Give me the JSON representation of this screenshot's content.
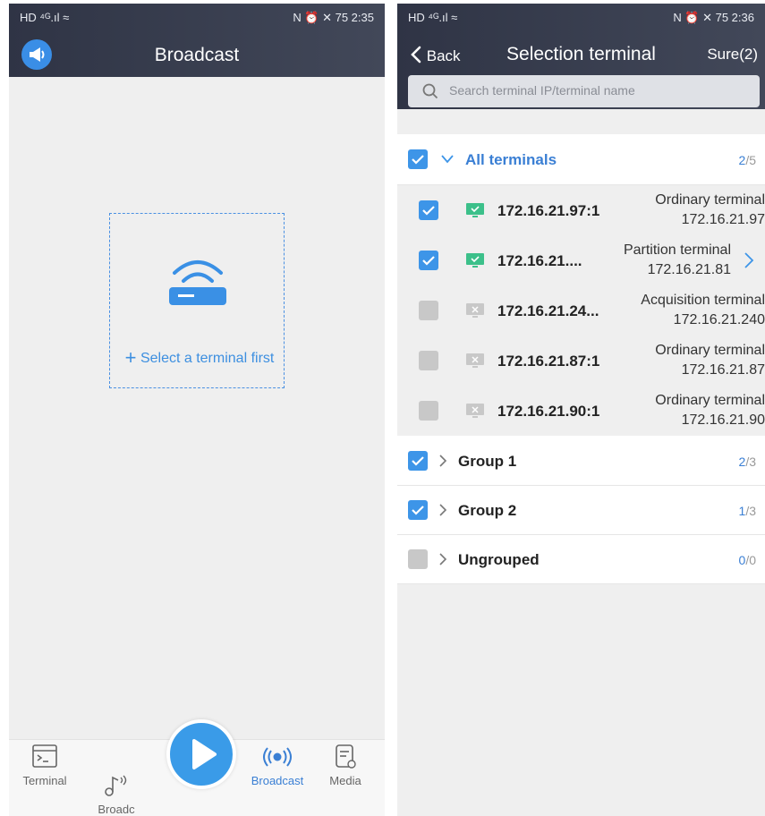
{
  "left": {
    "status": {
      "left": "HD ⁴ᴳ.ıl ≈",
      "right": "N ⏰ ✕ 75 2:35"
    },
    "title": "Broadcast",
    "select_label": "Select a terminal first",
    "nav": [
      {
        "label": "Terminal",
        "icon": "terminal-icon"
      },
      {
        "label": "Broadc\nasting\nroom",
        "icon": "music-note-icon"
      },
      {
        "label": "Broadcast",
        "icon": "broadcast-icon",
        "active": true
      },
      {
        "label": "Media",
        "icon": "media-icon"
      }
    ],
    "play_icon": "play-icon"
  },
  "right": {
    "status": {
      "left": "HD ⁴ᴳ.ıl ≈",
      "right": "N ⏰ ✕ 75 2:36"
    },
    "back_label": "Back",
    "title": "Selection terminal",
    "sure_label": "Sure(2)",
    "search_placeholder": "Search terminal IP/terminal name",
    "all_group": {
      "name": "All terminals",
      "count_sel": "2",
      "count_total": "/5",
      "checked": true,
      "expanded": true
    },
    "terminals": [
      {
        "ip": "172.16.21.97:1",
        "type": "Ordinary terminal",
        "addr": "172.16.21.97",
        "checked": true,
        "online": true,
        "chevron": false
      },
      {
        "ip": "172.16.21....",
        "type": "Partition terminal",
        "addr": "172.16.21.81",
        "checked": true,
        "online": true,
        "chevron": true
      },
      {
        "ip": "172.16.21.24...",
        "type": "Acquisition terminal",
        "addr": "172.16.21.240",
        "checked": false,
        "online": false,
        "chevron": false
      },
      {
        "ip": "172.16.21.87:1",
        "type": "Ordinary terminal",
        "addr": "172.16.21.87",
        "checked": false,
        "online": false,
        "chevron": false
      },
      {
        "ip": "172.16.21.90:1",
        "type": "Ordinary terminal",
        "addr": "172.16.21.90",
        "checked": false,
        "online": false,
        "chevron": false
      }
    ],
    "groups": [
      {
        "name": "Group 1",
        "count_sel": "2",
        "count_total": "/3",
        "checked": true
      },
      {
        "name": "Group 2",
        "count_sel": "1",
        "count_total": "/3",
        "checked": true
      },
      {
        "name": "Ungrouped",
        "count_sel": "0",
        "count_total": "/0",
        "checked": false
      }
    ]
  },
  "colors": {
    "accent": "#3d95e8",
    "header": "#363b4c",
    "online": "#3cc08a",
    "offline": "#c8c8c8"
  }
}
